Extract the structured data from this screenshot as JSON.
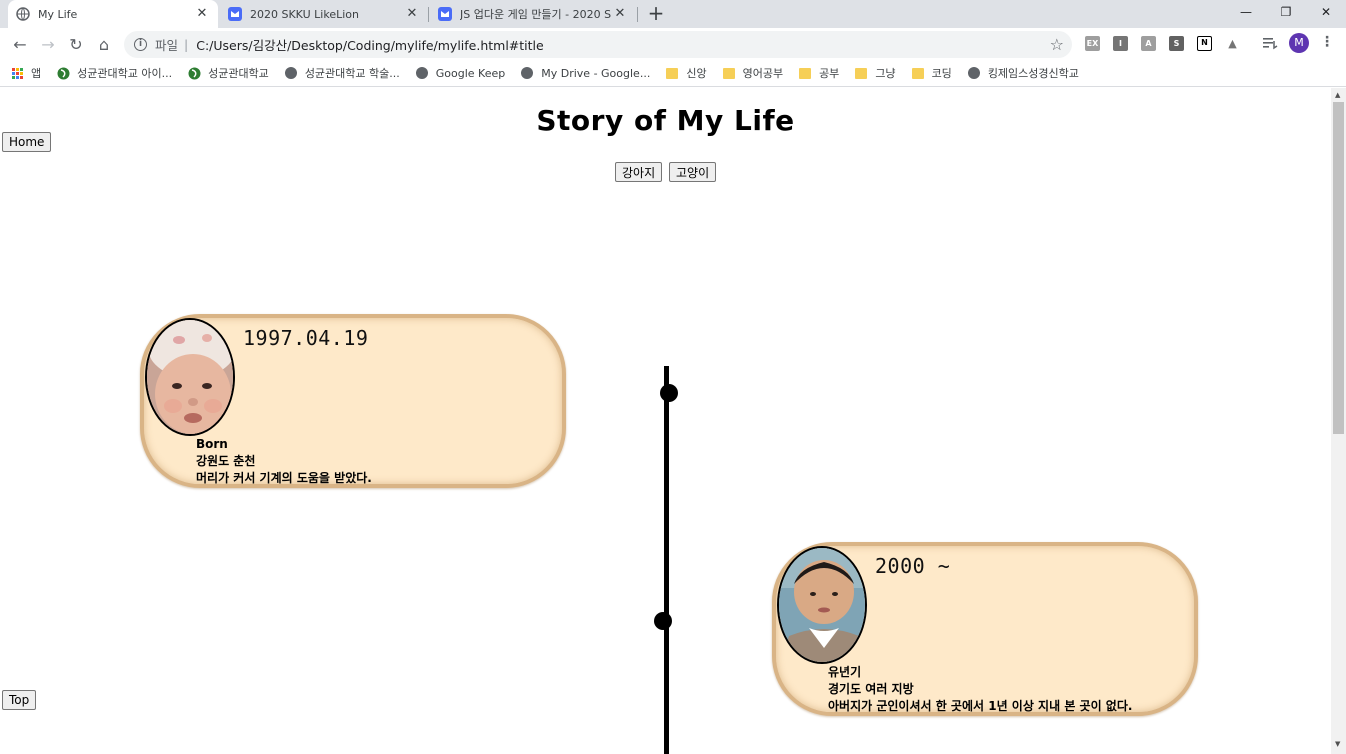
{
  "browser": {
    "tabs": [
      {
        "title": "My Life",
        "active": true
      },
      {
        "title": "2020 SKKU LikeLion",
        "active": false
      },
      {
        "title": "JS 업다운 게임 만들기 - 2020 S",
        "active": false
      }
    ],
    "new_tab_label": "+",
    "window_controls": {
      "minimize": "—",
      "restore": "❐",
      "close": "✕"
    },
    "nav": {
      "back": "←",
      "forward": "→",
      "reload": "↻",
      "home": "⌂"
    },
    "address": {
      "scheme_label": "파일",
      "separator": "|",
      "url": "C:/Users/김강산/Desktop/Coding/mylife/mylife.html#title"
    },
    "bookmark_star": "☆",
    "extensions": [
      "EX",
      "I",
      "A",
      "S",
      "N",
      "▲"
    ],
    "profile_initial": "M",
    "menu": "⋮",
    "bookmarks": [
      {
        "label": "앱",
        "kind": "apps"
      },
      {
        "label": "성균관대학교 아이...",
        "kind": "site"
      },
      {
        "label": "성균관대학교",
        "kind": "site"
      },
      {
        "label": "성균관대학교 학술...",
        "kind": "globe"
      },
      {
        "label": "Google Keep",
        "kind": "globe"
      },
      {
        "label": "My Drive - Google...",
        "kind": "globe"
      },
      {
        "label": "신앙",
        "kind": "folder"
      },
      {
        "label": "영어공부",
        "kind": "folder"
      },
      {
        "label": "공부",
        "kind": "folder"
      },
      {
        "label": "그냥",
        "kind": "folder"
      },
      {
        "label": "코딩",
        "kind": "folder"
      },
      {
        "label": "킹제임스성경신학교",
        "kind": "globe"
      }
    ]
  },
  "page": {
    "title": "Story of My Life",
    "home_button": "Home",
    "top_button": "Top",
    "filter_buttons": [
      "강아지",
      "고양이"
    ],
    "timeline": [
      {
        "date": "1997.04.19",
        "lines": [
          "Born",
          "강원도 춘천",
          "머리가 커서 기계의 도움을 받았다."
        ]
      },
      {
        "date": "2000 ~",
        "lines": [
          "유년기",
          "경기도 여러 지방",
          "아버지가 군인이셔서 한 곳에서 1년 이상 지내 본 곳이 없다."
        ]
      }
    ]
  },
  "colors": {
    "card_fill": "#fee9c9",
    "card_border": "#d9b486",
    "tabstrip": "#dee1e6",
    "omnibox": "#f1f3f4",
    "accent_profile": "#5e35b1"
  }
}
